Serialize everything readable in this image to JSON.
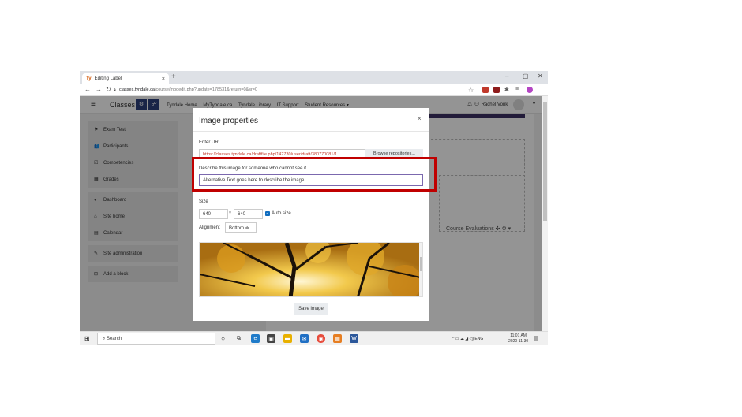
{
  "browser": {
    "tab_title": "Editing Label",
    "tab_icon": "Ty",
    "new_tab": "+",
    "url_host": "classes.tyndale.ca",
    "url_path": "/course/modedit.php?update=178531&return=0&sr=0",
    "minimize": "–",
    "maximize": "▢",
    "close": "✕"
  },
  "header": {
    "brand": "Classes",
    "nav_items": [
      "Tyndale Home",
      "MyTyndale.ca",
      "Tyndale Library",
      "IT Support",
      "Student Resources ▾"
    ],
    "user_name": "Rachel Vonk"
  },
  "sidebar": {
    "group1": [
      {
        "icon": "⚑",
        "label": "Exam Test"
      },
      {
        "icon": "👥",
        "label": "Participants"
      },
      {
        "icon": "☑",
        "label": "Competencies"
      },
      {
        "icon": "▦",
        "label": "Grades"
      }
    ],
    "group2": [
      {
        "icon": "◕",
        "label": "Dashboard"
      },
      {
        "icon": "⌂",
        "label": "Site home"
      },
      {
        "icon": "▤",
        "label": "Calendar"
      }
    ],
    "group3": [
      {
        "icon": "✎",
        "label": "Site administration"
      }
    ],
    "group4": [
      {
        "icon": "⊞",
        "label": "Add a block"
      }
    ]
  },
  "main": {
    "course_evaluations": "Course Evaluations ✢ ⚙ ▾"
  },
  "modal": {
    "title": "Image properties",
    "close": "×",
    "url_label": "Enter URL",
    "url_value": "https://classes.tyndale.ca/draftfile.php/142730/user/draft/380770081/1",
    "browse_label": "Browse repositories...",
    "alt_label": "Describe this image for someone who cannot see it",
    "alt_value": "Alternative Text goes here to describe the image",
    "size_label": "Size",
    "width": "640",
    "times": "x",
    "height": "640",
    "auto_size_label": "Auto size",
    "alignment_label": "Alignment",
    "alignment_value": "Bottom ≑",
    "save_label": "Save image"
  },
  "taskbar": {
    "search_placeholder": "Search",
    "tray_text": "^ ▭ ☁ ◢ ◁) ENG",
    "time": "11:01 AM",
    "date": "2020-11-30"
  },
  "colors": {
    "annotation": "#c00000",
    "brand_dark": "#2c3e7a",
    "link_red": "#c0392b"
  }
}
